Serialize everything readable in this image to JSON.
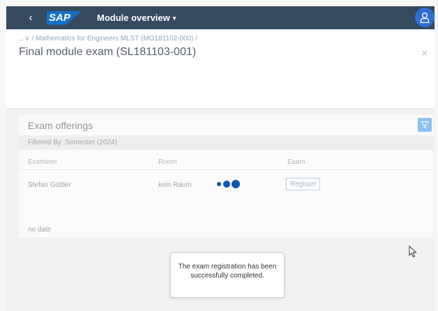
{
  "shell": {
    "back": "‹",
    "logo": "SAP",
    "title": "Module overview",
    "title_caret": "▾",
    "avatar_icon": "person-icon"
  },
  "header": {
    "breadcrumb": "...∨ / Mathematics for Engineers MLST (MO181102-000) /",
    "title": "Final module exam (SL181103-001)",
    "close": "×"
  },
  "offerings": {
    "title": "Exam offerings",
    "filter_text": "Filtered By: Semester (2024)",
    "columns": [
      "Examiner",
      "Room",
      "Exam"
    ],
    "row": {
      "examiner": "Stefan Güttler",
      "room": "kein Raum",
      "button": "Register"
    },
    "no_date": "no date"
  },
  "toast": {
    "message": "The exam registration has been successfully completed."
  },
  "colors": {
    "shell_bg": "#354a5f",
    "accent": "#1570c8",
    "busy_dots": "#0a59b5"
  }
}
